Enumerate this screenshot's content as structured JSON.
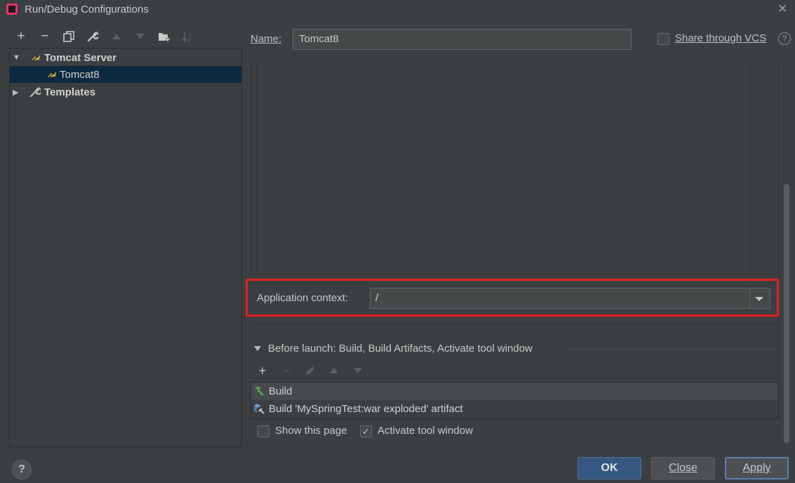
{
  "window": {
    "title": "Run/Debug Configurations",
    "close_glyph": "✕"
  },
  "toolbar": {
    "add": "+",
    "remove": "−"
  },
  "tree": {
    "items": [
      {
        "label": "Tomcat Server",
        "expanded": true
      },
      {
        "label": "Tomcat8",
        "selected": true
      },
      {
        "label": "Templates",
        "expanded": false
      }
    ]
  },
  "form": {
    "name_label": "Name:",
    "name_value": "Tomcat8",
    "share_label": "Share through VCS",
    "share_checked": false,
    "help_glyph": "?",
    "app_context_label": "Application context:",
    "app_context_value": "/"
  },
  "before_launch": {
    "label": "Before launch: Build, Build Artifacts, Activate tool window",
    "tools": {
      "add": "+",
      "remove": "−"
    },
    "tasks": [
      {
        "label": "Build",
        "icon": "hammer-icon"
      },
      {
        "label": "Build 'MySpringTest:war exploded' artifact",
        "icon": "artifact-icon"
      }
    ],
    "show_page_label": "Show this page",
    "show_page_checked": false,
    "activate_label": "Activate tool window",
    "activate_checked": true,
    "check_glyph": "✓"
  },
  "buttons": {
    "help": "?",
    "ok": "OK",
    "close": "Close",
    "apply": "Apply"
  },
  "colors": {
    "background": "#3c3f41",
    "selection": "#0d293e",
    "highlight_border": "#e02020",
    "ok_button": "#365880"
  }
}
